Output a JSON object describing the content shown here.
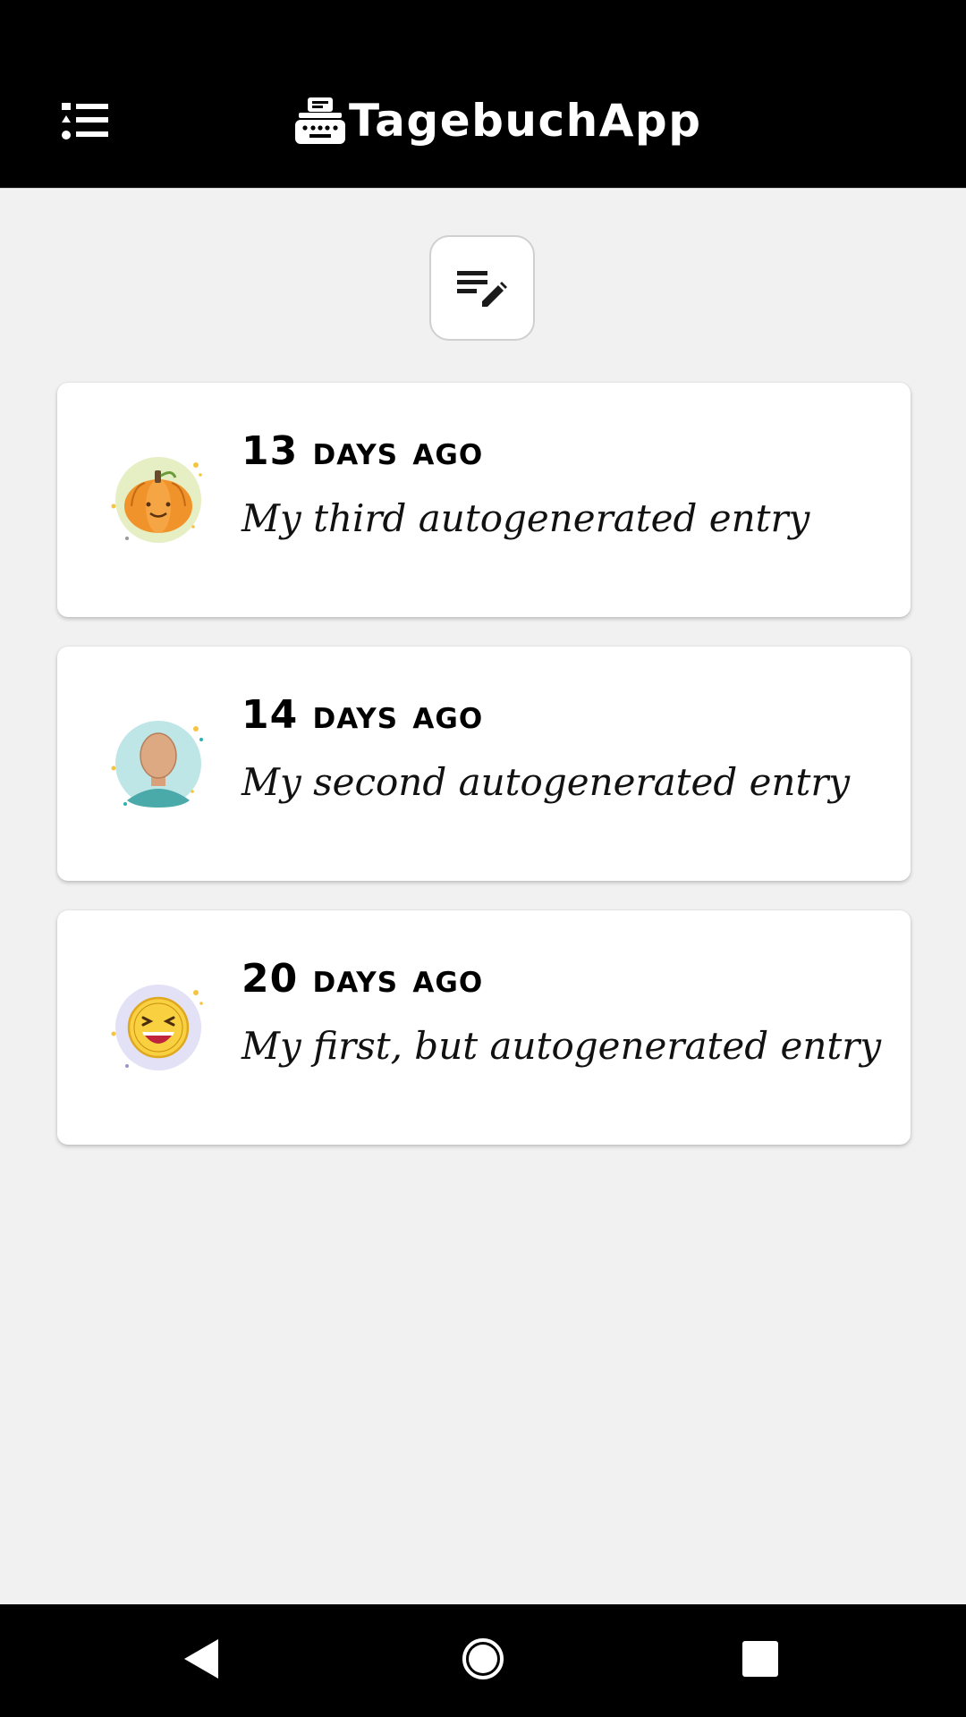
{
  "header": {
    "title": "TagebuchApp",
    "menu_icon": "list-icon",
    "logo_icon": "typewriter-icon"
  },
  "new_entry_button": {
    "icon": "edit-note-icon"
  },
  "entries": [
    {
      "date": "13 days ago",
      "text": "My third autogenerated entry",
      "avatar": "pumpkin-avatar-icon",
      "avatar_bg": "#e6efc3"
    },
    {
      "date": "14 days ago",
      "text": "My second autogenerated entry",
      "avatar": "person-avatar-icon",
      "avatar_bg": "#bfe6e6"
    },
    {
      "date": "20 days ago",
      "text": "My first, but autogenerated entry",
      "avatar": "laughing-face-avatar-icon",
      "avatar_bg": "#e3e1f6"
    }
  ],
  "navbar": {
    "back_icon": "back-triangle-icon",
    "home_icon": "home-circle-icon",
    "recents_icon": "recents-square-icon"
  },
  "colors": {
    "header_bg": "#000000",
    "page_bg": "#f1f1f1",
    "card_bg": "#ffffff"
  }
}
